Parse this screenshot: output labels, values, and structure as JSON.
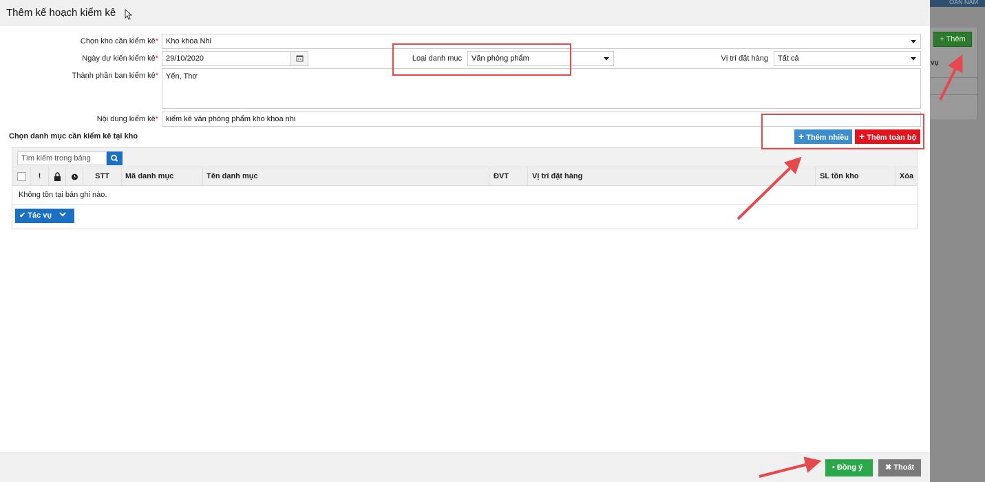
{
  "background_app": {
    "top_strip_text": "OÀN NĂM",
    "add_button_label": "+ Thêm",
    "column_partial": "vụ"
  },
  "modal": {
    "title": "Thêm kế hoạch kiểm kê",
    "form": {
      "warehouse_label": "Chọn kho cần kiểm kê",
      "warehouse_value": "Kho khoa Nhi",
      "planned_date_label": "Ngày dự kiến kiểm kê",
      "planned_date_value": "29/10/2020",
      "category_type_label": "Loại danh mục",
      "category_type_value": "Văn phòng phẩm",
      "location_label": "Vị trí đặt hàng",
      "location_value": "Tất cả",
      "committee_label": "Thành phần ban kiểm kê",
      "committee_value": "Yến, Thơ",
      "content_label": "Nội dung kiểm kê",
      "content_value": "kiểm kê văn phòng phẩm kho khoa nhi",
      "required_mark": "*"
    },
    "section_title": "Chọn danh mục cần kiểm kê tại kho",
    "buttons": {
      "add_many": "Thêm nhiều",
      "add_all": "Thêm toàn bộ"
    },
    "table": {
      "search_placeholder": "Tìm kiếm trong bảng",
      "columns": {
        "warning": "!",
        "stt": "STT",
        "code": "Mã danh mục",
        "name": "Tên danh mục",
        "unit": "ĐVT",
        "location": "Vị trí đặt hàng",
        "stock": "SL tồn kho",
        "delete": "Xóa"
      },
      "empty_message": "Không tồn tại bản ghi nào.",
      "actions_label": "Tác vụ"
    },
    "footer": {
      "confirm_label": "Đồng ý",
      "exit_label": "Thoát"
    }
  },
  "colors": {
    "highlight": "#e8474c",
    "primary_blue": "#3c8dcb",
    "danger_red": "#e3141e",
    "success_green": "#2aa84a"
  }
}
